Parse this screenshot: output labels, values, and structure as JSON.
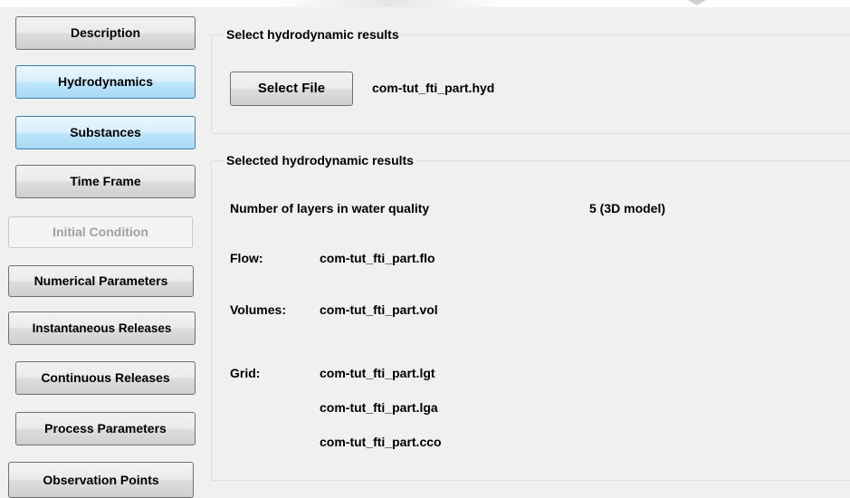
{
  "nav": {
    "description": "Description",
    "hydrodynamics": "Hydrodynamics",
    "substances": "Substances",
    "time_frame": "Time Frame",
    "initial_condition": "Initial Condition",
    "numerical_parameters": "Numerical Parameters",
    "instantaneous_releases": "Instantaneous Releases",
    "continuous_releases": "Continuous Releases",
    "process_parameters": "Process Parameters",
    "observation_points": "Observation Points"
  },
  "select_group": {
    "title": "Select  hydrodynamic  results",
    "button_label": "Select File",
    "file_name": "com-tut_fti_part.hyd"
  },
  "results_group": {
    "title": "Selected hydrodynamic results",
    "layers_label": "Number of layers in water quality",
    "layers_value": "5 (3D model)",
    "flow_label": "Flow:",
    "flow_file": "com-tut_fti_part.flo",
    "volumes_label": "Volumes:",
    "volumes_file": "com-tut_fti_part.vol",
    "grid_label": "Grid:",
    "grid_files": [
      "com-tut_fti_part.lgt",
      "com-tut_fti_part.lga",
      "com-tut_fti_part.cco"
    ]
  },
  "colors": {
    "active_button": "#bee6fd",
    "panel_background": "#f0f0f0",
    "disabled_text": "#a0a0a0"
  }
}
